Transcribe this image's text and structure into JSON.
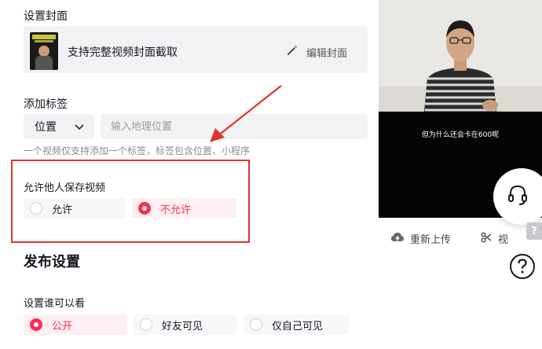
{
  "cover": {
    "title": "设置封面",
    "description": "支持完整视频封面截取",
    "edit_label": "编辑封面"
  },
  "tag": {
    "title": "添加标签",
    "type_value": "位置",
    "location_placeholder": "输入地理位置",
    "hint": "一个视频仅支持添加一个标签，标签包含位置、小程序"
  },
  "save": {
    "title": "允许他人保存视频",
    "options": [
      {
        "label": "允许",
        "selected": false
      },
      {
        "label": "不允许",
        "selected": true
      }
    ]
  },
  "publish": {
    "title": "发布设置",
    "visibility_title": "设置谁可以看",
    "options": [
      {
        "label": "公开",
        "selected": true
      },
      {
        "label": "好友可见",
        "selected": false
      },
      {
        "label": "仅自己可见",
        "selected": false
      }
    ]
  },
  "preview": {
    "caption": "但为什么还会卡在600呢",
    "reupload_label": "重新上传",
    "cut_label": "视"
  },
  "colors": {
    "accent": "#fe2c55",
    "annotation_red": "#e0352b"
  }
}
